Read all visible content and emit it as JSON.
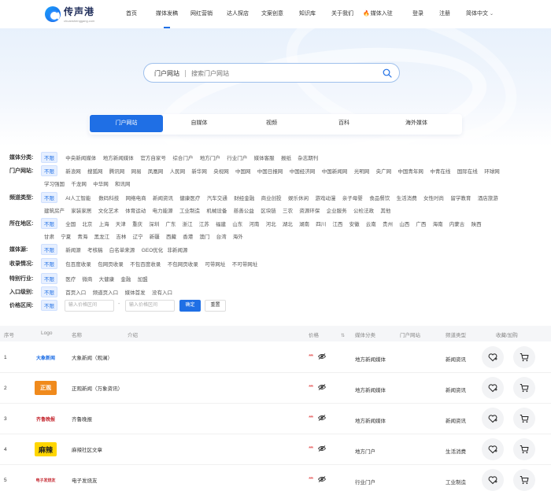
{
  "site": {
    "logo_title": "传声港",
    "logo_sub": "chuanshenggang.com"
  },
  "nav": {
    "items": [
      {
        "label": "首页"
      },
      {
        "label": "媒体发稿"
      },
      {
        "label": "网红营销"
      },
      {
        "label": "达人探店"
      },
      {
        "label": "文案创意"
      },
      {
        "label": "知识库"
      },
      {
        "label": "关于我们"
      },
      {
        "label": "媒体入驻"
      },
      {
        "label": "登录"
      },
      {
        "label": "注册"
      },
      {
        "label": "简体中文"
      }
    ],
    "active_index": 1
  },
  "search": {
    "category": "门户网站",
    "placeholder": "搜索门户网站"
  },
  "category_tabs": [
    {
      "label": "门户网站"
    },
    {
      "label": "自媒体"
    },
    {
      "label": "视频"
    },
    {
      "label": "百科"
    },
    {
      "label": "海外媒体"
    }
  ],
  "filters": [
    {
      "label": "媒体分类:",
      "options": [
        "不限",
        "中央新闻媒体",
        "地方新闻媒体",
        "官方自家号",
        "综合门户",
        "地方门户",
        "行业门户",
        "媒体客服",
        "报纸",
        "杂志期刊"
      ]
    },
    {
      "label": "门户网站:",
      "options": [
        "不限",
        "新浪网",
        "搜狐网",
        "腾讯网",
        "网易",
        "凤凰网",
        "人民网",
        "新华网",
        "央视网",
        "中国网",
        "中国日报网",
        "中国经济网",
        "中国新闻网",
        "光明网",
        "央广网",
        "中国青年网",
        "中青在线",
        "国际在线",
        "环球网"
      ],
      "options2": [
        "学习强国",
        "千龙网",
        "中华网",
        "和讯网"
      ]
    },
    {
      "label": "频道类型:",
      "options": [
        "不限",
        "AI人工智能",
        "数码科技",
        "网络电商",
        "新闻资讯",
        "健康医疗",
        "汽车交通",
        "财经金融",
        "商业创投",
        "娱乐休闲",
        "游戏动漫",
        "亲子母婴",
        "食品餐饮",
        "生活消费",
        "女性时尚",
        "留学教育",
        "酒店旅游"
      ],
      "options2": [
        "建筑房产",
        "家装家居",
        "文化艺术",
        "体育运动",
        "电力能源",
        "工业制造",
        "机械设备",
        "慈善公益",
        "区块链",
        "三农",
        "资源环保",
        "企业服务",
        "公检法政",
        "其他"
      ]
    },
    {
      "label": "所在地区:",
      "options": [
        "不限",
        "全国",
        "北京",
        "上海",
        "天津",
        "重庆",
        "深圳",
        "广东",
        "浙江",
        "江苏",
        "福建",
        "山东",
        "河南",
        "河北",
        "湖北",
        "湖南",
        "四川",
        "江西",
        "安徽",
        "云南",
        "贵州",
        "山西",
        "广西",
        "海南",
        "内蒙古",
        "陕西"
      ],
      "options2": [
        "甘肃",
        "宁夏",
        "青海",
        "黑龙江",
        "吉林",
        "辽宁",
        "新疆",
        "西藏",
        "香港",
        "澳门",
        "台湾",
        "海外"
      ]
    },
    {
      "label": "媒体源:",
      "options": [
        "不限",
        "新闻源",
        "考核稿",
        "白名单来源",
        "GEO优化",
        "非新闻源"
      ]
    },
    {
      "label": "收录情况:",
      "options": [
        "不限",
        "包百度收录",
        "包网页收录",
        "不包百度收录",
        "不包网页收录",
        "可带网址",
        "不可带网址"
      ]
    },
    {
      "label": "特别行业:",
      "options": [
        "不限",
        "医疗",
        "微商",
        "大健康",
        "金融",
        "加盟"
      ]
    },
    {
      "label": "入口级别:",
      "options": [
        "不限",
        "首页入口",
        "频道页入口",
        "媒体首发",
        "没有入口"
      ]
    }
  ],
  "price_filter": {
    "label": "价格区间:",
    "min_placeholder": "输入价格区间",
    "max_placeholder": "输入价格区间",
    "dash": "-",
    "confirm": "确定",
    "reset": "重置"
  },
  "table": {
    "headers": [
      "序号",
      "Logo",
      "名称",
      "介绍",
      "价格",
      "媒体分类",
      "门户网站",
      "频道类型",
      "收藏/加购"
    ],
    "rows": [
      {
        "index": "1",
        "logo_text": "大象新闻",
        "name": "大象新闻（观澜）",
        "price": "***",
        "media_type": "地方新闻媒体",
        "portal": "",
        "channel": "新闻资讯"
      },
      {
        "index": "2",
        "logo_text": "正观",
        "name": "正观新闻（万象资讯）",
        "price": "***",
        "media_type": "地方新闻媒体",
        "portal": "",
        "channel": "新闻资讯"
      },
      {
        "index": "3",
        "logo_text": "齐鲁晚报",
        "name": "齐鲁晚报",
        "price": "***",
        "media_type": "地方新闻媒体",
        "portal": "",
        "channel": "新闻资讯"
      },
      {
        "index": "4",
        "logo_text": "麻辣",
        "name": "麻辣社区文章",
        "price": "***",
        "media_type": "地方门户",
        "portal": "",
        "channel": "生活消费"
      },
      {
        "index": "5",
        "logo_text": "电子发烧友",
        "name": "电子发烧友",
        "price": "***",
        "media_type": "行业门户",
        "portal": "",
        "channel": "工业制造"
      }
    ]
  },
  "colors": {
    "accent": "#1f6fe5",
    "price_mask": "#e03a3a"
  }
}
